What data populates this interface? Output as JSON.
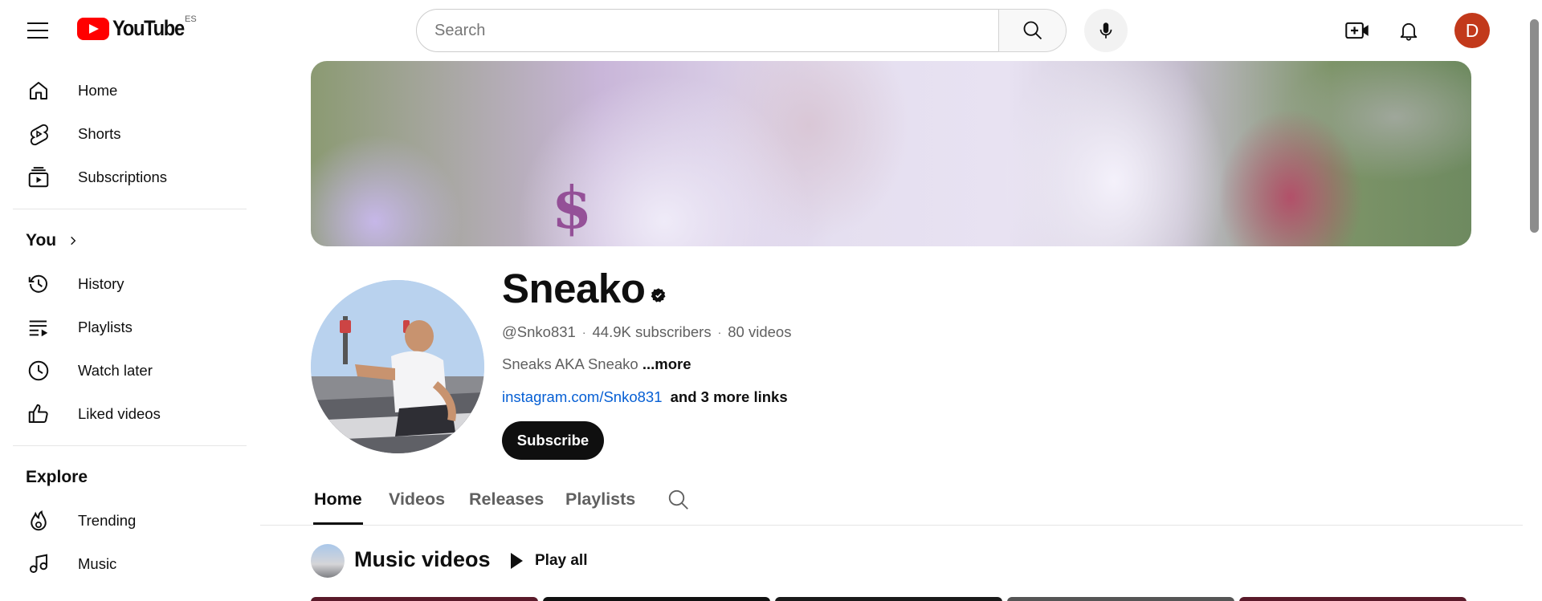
{
  "masthead": {
    "logo_text": "YouTube",
    "country_code": "ES",
    "search_placeholder": "Search",
    "avatar_letter": "D",
    "avatar_color": "#c2391b"
  },
  "sidebar": {
    "primary": [
      {
        "label": "Home",
        "icon": "home-icon"
      },
      {
        "label": "Shorts",
        "icon": "shorts-icon"
      },
      {
        "label": "Subscriptions",
        "icon": "subscriptions-icon"
      }
    ],
    "you_title": "You",
    "you_items": [
      {
        "label": "History",
        "icon": "history-icon"
      },
      {
        "label": "Playlists",
        "icon": "playlists-icon"
      },
      {
        "label": "Watch later",
        "icon": "watch-later-icon"
      },
      {
        "label": "Liked videos",
        "icon": "liked-icon"
      }
    ],
    "explore_title": "Explore",
    "explore_items": [
      {
        "label": "Trending",
        "icon": "trending-icon"
      },
      {
        "label": "Music",
        "icon": "music-icon"
      }
    ]
  },
  "channel": {
    "name": "Sneako",
    "handle": "@Snko831",
    "subscribers": "44.9K subscribers",
    "videos": "80 videos",
    "description": "Sneaks AKA Sneako",
    "more_label": "...more",
    "link": "instagram.com/Snko831",
    "more_links": "and 3 more links",
    "subscribe_label": "Subscribe",
    "banner_text": "$"
  },
  "tabs": [
    {
      "label": "Home",
      "active": true
    },
    {
      "label": "Videos",
      "active": false
    },
    {
      "label": "Releases",
      "active": false
    },
    {
      "label": "Playlists",
      "active": false
    }
  ],
  "shelf": {
    "title": "Music videos",
    "play_all_label": "Play all"
  },
  "colors": {
    "brand_red": "#ff0000",
    "link_blue": "#065fd4",
    "text_secondary": "#606060"
  }
}
